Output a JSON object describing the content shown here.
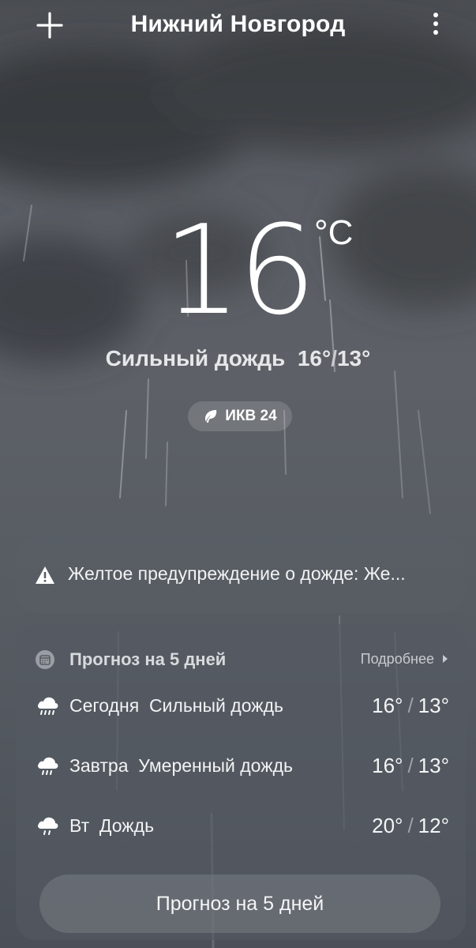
{
  "header": {
    "city": "Нижний Новгород",
    "add_icon": "plus-icon",
    "menu_icon": "more-vertical-icon"
  },
  "current": {
    "temperature": "16",
    "unit": "°C",
    "condition": "Сильный дождь",
    "high": "16°",
    "low": "13°",
    "aqi_label": "ИКВ 24",
    "aqi_icon": "leaf-icon"
  },
  "alert": {
    "icon": "warning-icon",
    "text": "Желтое предупреждение о дожде: Же..."
  },
  "forecast": {
    "title": "Прогноз на 5 дней",
    "more_label": "Подробнее",
    "icon": "calendar-icon",
    "days": [
      {
        "day": "Сегодня",
        "condition": "Сильный дождь",
        "high": "16°",
        "low": "13°",
        "icon": "heavy-rain-icon"
      },
      {
        "day": "Завтра",
        "condition": "Умеренный дождь",
        "high": "16°",
        "low": "13°",
        "icon": "moderate-rain-icon"
      },
      {
        "day": "Вт",
        "condition": "Дождь",
        "high": "20°",
        "low": "12°",
        "icon": "rain-icon"
      }
    ],
    "button_label": "Прогноз на 5 дней"
  },
  "colors": {
    "background": "#5a5e64",
    "card": "#555a62",
    "text": "#ffffff"
  }
}
